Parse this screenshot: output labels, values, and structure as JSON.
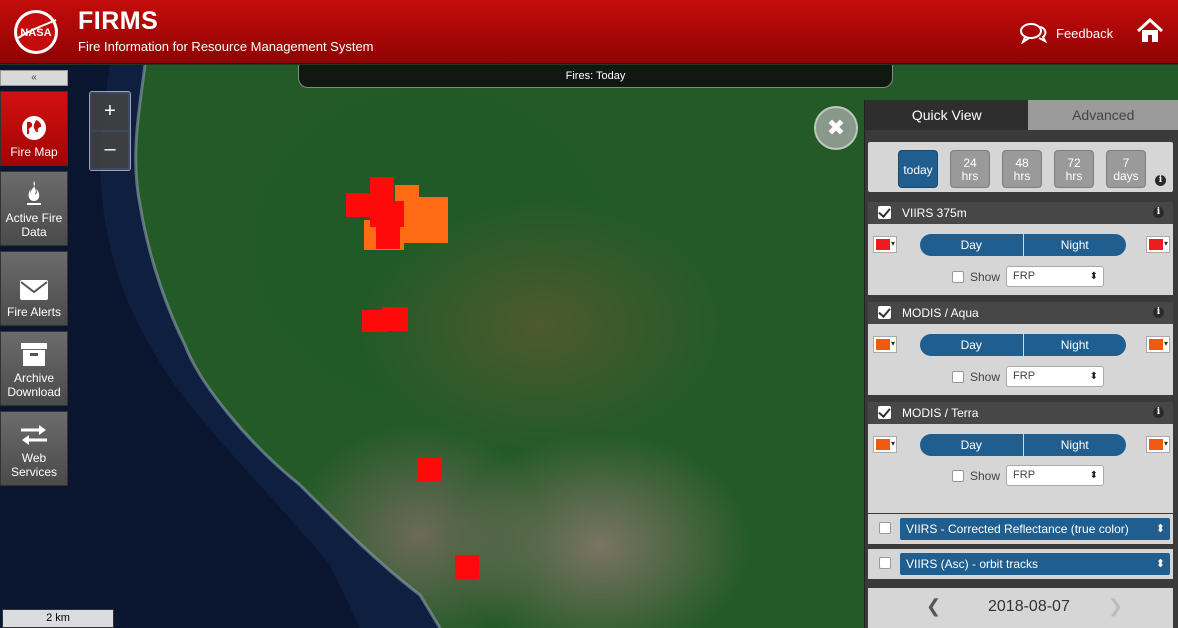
{
  "header": {
    "title": "FIRMS",
    "subtitle": "Fire Information for Resource Management System",
    "logo_text": "NASA",
    "feedback_label": "Feedback"
  },
  "map": {
    "fires_label": "Fires: Today",
    "scale_label": "2 km",
    "zoom_in": "+",
    "zoom_out": "–",
    "close_symbol": "✖"
  },
  "nav": {
    "collapse_symbol": "«",
    "items": [
      {
        "label": "Fire Map",
        "icon": "globe-icon",
        "active": true
      },
      {
        "label": "Active Fire Data",
        "icon": "flame-icon",
        "active": false
      },
      {
        "label": "Fire Alerts",
        "icon": "envelope-icon",
        "active": false
      },
      {
        "label": "Archive Download",
        "icon": "archive-box-icon",
        "active": false
      },
      {
        "label": "Web Services",
        "icon": "arrows-swap-icon",
        "active": false
      }
    ]
  },
  "panel": {
    "tabs": [
      {
        "label": "Quick View",
        "active": true
      },
      {
        "label": "Advanced",
        "active": false
      }
    ],
    "time_buttons": [
      {
        "line1": "today",
        "line2": "",
        "active": true
      },
      {
        "line1": "24",
        "line2": "hrs",
        "active": false
      },
      {
        "line1": "48",
        "line2": "hrs",
        "active": false
      },
      {
        "line1": "72",
        "line2": "hrs",
        "active": false
      },
      {
        "line1": "7",
        "line2": "days",
        "active": false
      }
    ],
    "info_symbol": "i",
    "layers": [
      {
        "name": "VIIRS 375m",
        "color": "#ee1c1c",
        "checked": true
      },
      {
        "name": "MODIS / Aqua",
        "color": "#f05a0e",
        "checked": true
      },
      {
        "name": "MODIS / Terra",
        "color": "#f05a0e",
        "checked": true
      }
    ],
    "day_label": "Day",
    "night_label": "Night",
    "show_label": "Show",
    "show_select_value": "FRP",
    "overlays": [
      {
        "label": "VIIRS - Corrected Reflectance (true color)",
        "checked": false
      },
      {
        "label": "VIIRS (Asc) - orbit tracks",
        "checked": false
      }
    ],
    "date": "2018-08-07",
    "prev_symbol": "❮",
    "next_symbol": "❯"
  },
  "colors": {
    "header_red": "#c40c0c",
    "accent_blue": "#1f5e8e",
    "fire_red": "#ff0a0a",
    "fire_orange": "#ff6a14"
  }
}
